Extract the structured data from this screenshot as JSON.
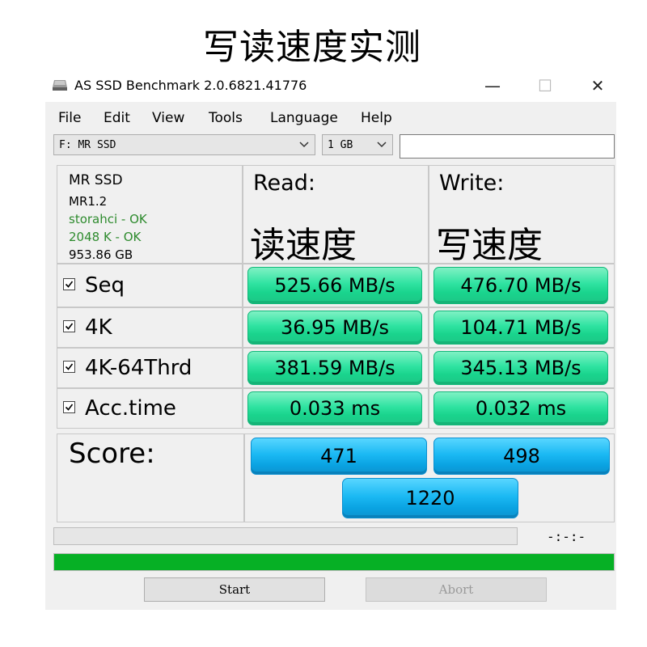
{
  "banner": {
    "title": "写读速度实测"
  },
  "window": {
    "title": "AS SSD Benchmark 2.0.6821.41776",
    "icon": "drive-icon",
    "controls": {
      "minimize": "—",
      "maximize": "☐",
      "close": "✕"
    }
  },
  "menu": [
    "File",
    "Edit",
    "View",
    "Tools",
    "Language",
    "Help"
  ],
  "toolbar": {
    "drive_select": "F: MR SSD",
    "size_select": "1 GB",
    "text_field": ""
  },
  "info": {
    "model": "MR SSD",
    "firmware": "MR1.2",
    "driver": "storahci - OK",
    "alignment": "2048 K - OK",
    "capacity": "953.86 GB"
  },
  "columns": {
    "read": {
      "head": "Read:",
      "note": "读速度"
    },
    "write": {
      "head": "Write:",
      "note": "写速度"
    }
  },
  "tests": [
    {
      "name": "Seq",
      "checked": true,
      "read": "525.66 MB/s",
      "write": "476.70 MB/s"
    },
    {
      "name": "4K",
      "checked": true,
      "read": "36.95 MB/s",
      "write": "104.71 MB/s"
    },
    {
      "name": "4K-64Thrd",
      "checked": true,
      "read": "381.59 MB/s",
      "write": "345.13 MB/s"
    },
    {
      "name": "Acc.time",
      "checked": true,
      "read": "0.033 ms",
      "write": "0.032 ms"
    }
  ],
  "score": {
    "label": "Score:",
    "read": "471",
    "write": "498",
    "total": "1220"
  },
  "status": {
    "elapsed": "-:-:-",
    "progress_fraction": 1.0,
    "progress_color": "#06b025"
  },
  "buttons": {
    "start": "Start",
    "abort": "Abort"
  },
  "colors": {
    "result_green": "#2fe3a1",
    "score_blue": "#1bb9f3",
    "info_green": "#2e8b2e"
  }
}
